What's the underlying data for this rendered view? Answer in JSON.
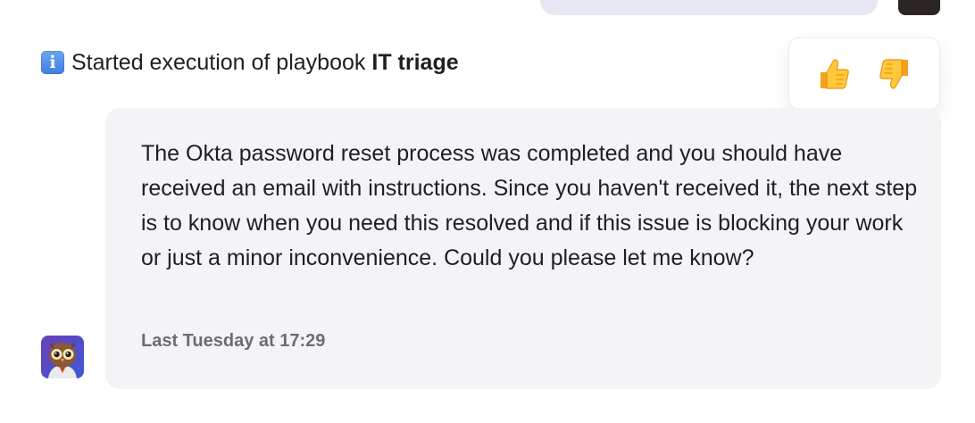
{
  "system_message": {
    "prefix": "Started execution of playbook",
    "playbook_name": "IT triage",
    "icon": "info-icon",
    "icon_glyph": "i"
  },
  "feedback": {
    "thumbs_up": "thumbs-up-icon",
    "thumbs_down": "thumbs-down-icon"
  },
  "assistant_message": {
    "text": "The Okta password reset process was completed and you should have received an email with instructions. Since you haven't received it, the next step is to know when you need this resolved and if this issue is blocking your work or just a minor inconvenience. Could you please let me know?",
    "timestamp": "Last Tuesday at 17:29",
    "avatar": "owl-avatar-icon"
  },
  "colors": {
    "bubble_bg": "#f4f4f7",
    "user_bubble_bg": "#e7e7f3",
    "timestamp": "#6c6c73",
    "info_icon": "#3f7fe0"
  }
}
